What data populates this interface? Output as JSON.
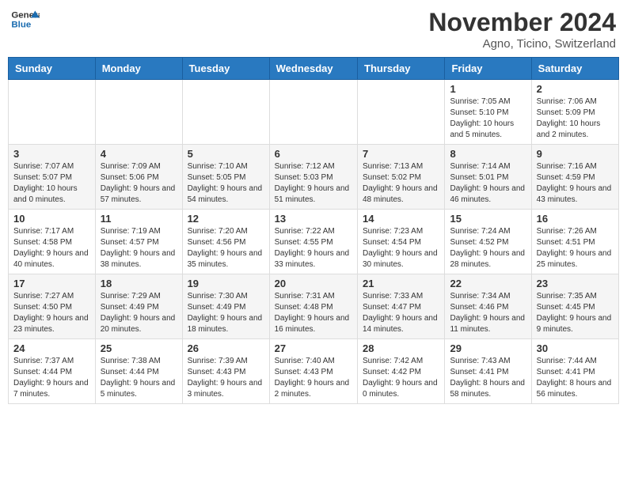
{
  "logo": {
    "text_general": "General",
    "text_blue": "Blue"
  },
  "header": {
    "month": "November 2024",
    "location": "Agno, Ticino, Switzerland"
  },
  "weekdays": [
    "Sunday",
    "Monday",
    "Tuesday",
    "Wednesday",
    "Thursday",
    "Friday",
    "Saturday"
  ],
  "weeks": [
    [
      {
        "day": "",
        "info": ""
      },
      {
        "day": "",
        "info": ""
      },
      {
        "day": "",
        "info": ""
      },
      {
        "day": "",
        "info": ""
      },
      {
        "day": "",
        "info": ""
      },
      {
        "day": "1",
        "info": "Sunrise: 7:05 AM\nSunset: 5:10 PM\nDaylight: 10 hours and 5 minutes."
      },
      {
        "day": "2",
        "info": "Sunrise: 7:06 AM\nSunset: 5:09 PM\nDaylight: 10 hours and 2 minutes."
      }
    ],
    [
      {
        "day": "3",
        "info": "Sunrise: 7:07 AM\nSunset: 5:07 PM\nDaylight: 10 hours and 0 minutes."
      },
      {
        "day": "4",
        "info": "Sunrise: 7:09 AM\nSunset: 5:06 PM\nDaylight: 9 hours and 57 minutes."
      },
      {
        "day": "5",
        "info": "Sunrise: 7:10 AM\nSunset: 5:05 PM\nDaylight: 9 hours and 54 minutes."
      },
      {
        "day": "6",
        "info": "Sunrise: 7:12 AM\nSunset: 5:03 PM\nDaylight: 9 hours and 51 minutes."
      },
      {
        "day": "7",
        "info": "Sunrise: 7:13 AM\nSunset: 5:02 PM\nDaylight: 9 hours and 48 minutes."
      },
      {
        "day": "8",
        "info": "Sunrise: 7:14 AM\nSunset: 5:01 PM\nDaylight: 9 hours and 46 minutes."
      },
      {
        "day": "9",
        "info": "Sunrise: 7:16 AM\nSunset: 4:59 PM\nDaylight: 9 hours and 43 minutes."
      }
    ],
    [
      {
        "day": "10",
        "info": "Sunrise: 7:17 AM\nSunset: 4:58 PM\nDaylight: 9 hours and 40 minutes."
      },
      {
        "day": "11",
        "info": "Sunrise: 7:19 AM\nSunset: 4:57 PM\nDaylight: 9 hours and 38 minutes."
      },
      {
        "day": "12",
        "info": "Sunrise: 7:20 AM\nSunset: 4:56 PM\nDaylight: 9 hours and 35 minutes."
      },
      {
        "day": "13",
        "info": "Sunrise: 7:22 AM\nSunset: 4:55 PM\nDaylight: 9 hours and 33 minutes."
      },
      {
        "day": "14",
        "info": "Sunrise: 7:23 AM\nSunset: 4:54 PM\nDaylight: 9 hours and 30 minutes."
      },
      {
        "day": "15",
        "info": "Sunrise: 7:24 AM\nSunset: 4:52 PM\nDaylight: 9 hours and 28 minutes."
      },
      {
        "day": "16",
        "info": "Sunrise: 7:26 AM\nSunset: 4:51 PM\nDaylight: 9 hours and 25 minutes."
      }
    ],
    [
      {
        "day": "17",
        "info": "Sunrise: 7:27 AM\nSunset: 4:50 PM\nDaylight: 9 hours and 23 minutes."
      },
      {
        "day": "18",
        "info": "Sunrise: 7:29 AM\nSunset: 4:49 PM\nDaylight: 9 hours and 20 minutes."
      },
      {
        "day": "19",
        "info": "Sunrise: 7:30 AM\nSunset: 4:49 PM\nDaylight: 9 hours and 18 minutes."
      },
      {
        "day": "20",
        "info": "Sunrise: 7:31 AM\nSunset: 4:48 PM\nDaylight: 9 hours and 16 minutes."
      },
      {
        "day": "21",
        "info": "Sunrise: 7:33 AM\nSunset: 4:47 PM\nDaylight: 9 hours and 14 minutes."
      },
      {
        "day": "22",
        "info": "Sunrise: 7:34 AM\nSunset: 4:46 PM\nDaylight: 9 hours and 11 minutes."
      },
      {
        "day": "23",
        "info": "Sunrise: 7:35 AM\nSunset: 4:45 PM\nDaylight: 9 hours and 9 minutes."
      }
    ],
    [
      {
        "day": "24",
        "info": "Sunrise: 7:37 AM\nSunset: 4:44 PM\nDaylight: 9 hours and 7 minutes."
      },
      {
        "day": "25",
        "info": "Sunrise: 7:38 AM\nSunset: 4:44 PM\nDaylight: 9 hours and 5 minutes."
      },
      {
        "day": "26",
        "info": "Sunrise: 7:39 AM\nSunset: 4:43 PM\nDaylight: 9 hours and 3 minutes."
      },
      {
        "day": "27",
        "info": "Sunrise: 7:40 AM\nSunset: 4:43 PM\nDaylight: 9 hours and 2 minutes."
      },
      {
        "day": "28",
        "info": "Sunrise: 7:42 AM\nSunset: 4:42 PM\nDaylight: 9 hours and 0 minutes."
      },
      {
        "day": "29",
        "info": "Sunrise: 7:43 AM\nSunset: 4:41 PM\nDaylight: 8 hours and 58 minutes."
      },
      {
        "day": "30",
        "info": "Sunrise: 7:44 AM\nSunset: 4:41 PM\nDaylight: 8 hours and 56 minutes."
      }
    ]
  ]
}
